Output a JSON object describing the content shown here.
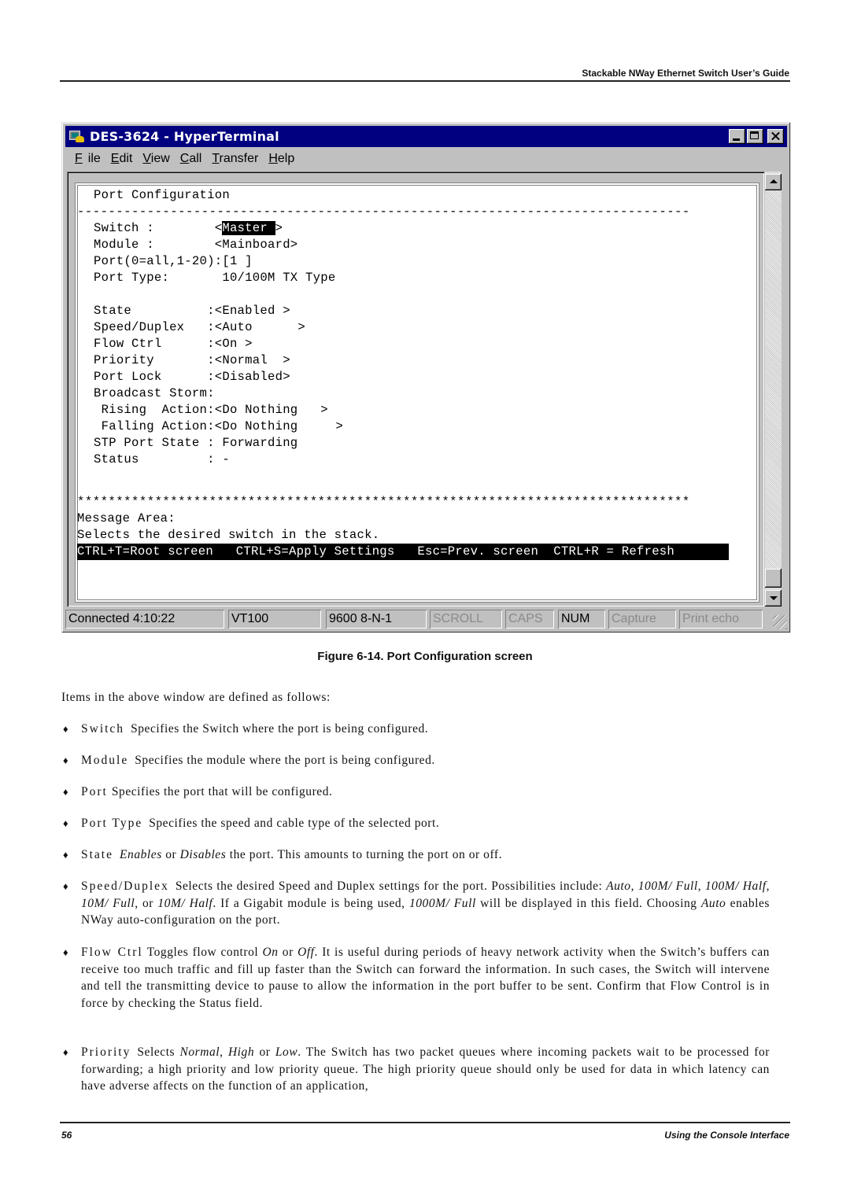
{
  "page": {
    "header_title": "Stackable NWay Ethernet Switch User’s Guide",
    "footer_page_number": "56",
    "footer_section": "Using the Console Interface",
    "figure_caption": "Figure 6-14.  Port Configuration screen"
  },
  "window": {
    "title": "DES-3624 - HyperTerminal",
    "menu": [
      {
        "label": "File",
        "accel": "F",
        "rest": "ile"
      },
      {
        "label": "Edit",
        "accel": "E",
        "rest": "dit"
      },
      {
        "label": "View",
        "accel": "V",
        "rest": "iew"
      },
      {
        "label": "Call",
        "accel": "C",
        "rest": "all"
      },
      {
        "label": "Transfer",
        "accel": "T",
        "rest": "ransfer"
      },
      {
        "label": "Help",
        "accel": "H",
        "rest": "elp"
      }
    ],
    "controls": {
      "minimize": "minimize",
      "maximize": "maximize",
      "close": "close"
    }
  },
  "terminal": {
    "heading": "Port Configuration",
    "dash_rule": "-------------------------------------------------------------------------------",
    "switch_label": "Switch :        <",
    "switch_value": "Master ",
    "switch_suffix": ">",
    "module_line": "Module :        <Mainboard>",
    "port_line": "Port(0=all,1-20):[1 ]",
    "port_type_line": "Port Type:       10/100M TX Type",
    "fields": [
      "State          :<Enabled >",
      "Speed/Duplex   :<Auto      >",
      "Flow Ctrl      :<On >",
      "Priority       :<Normal  >",
      "Port Lock      :<Disabled>",
      "Broadcast Storm:",
      " Rising  Action:<Do Nothing   >",
      " Falling Action:<Do Nothing     >",
      "STP Port State : Forwarding",
      "Status         : -"
    ],
    "star_rule": "*******************************************************************************",
    "message_area_label": "Message Area:",
    "message": "Selects the desired switch in the stack.",
    "keybar": "CTRL+T=Root screen   CTRL+S=Apply Settings   Esc=Prev. screen  CTRL+R = Refresh"
  },
  "statusbar": {
    "connected": "Connected 4:10:22",
    "emulation": "VT100",
    "port_settings": "9600 8-N-1",
    "scroll": "SCROLL",
    "caps": "CAPS",
    "num": "NUM",
    "capture": "Capture",
    "print_echo": "Print echo"
  },
  "body": {
    "intro": "Items in the above window are defined as follows:",
    "items": [
      {
        "term": "Switch",
        "text": "Specifies the Switch where the port is being configured."
      },
      {
        "term": "Module",
        "text": "Specifies the module where the port is being configured."
      },
      {
        "term": "Port",
        "text": "Specifies the port that will be configured."
      },
      {
        "term": "Port Type",
        "text": "Specifies the speed and cable type of the selected port."
      },
      {
        "term": "State",
        "parts": [
          "Enables",
          " or ",
          "Disables",
          " the port. This amounts to turning the port on or off."
        ]
      },
      {
        "term": "Speed/Duplex",
        "parts": [
          "Selects the desired Speed and Duplex settings for the port. Possibilities include: ",
          "Auto",
          ", ",
          "100M/ Full",
          ", ",
          "100M/ Half",
          ", ",
          "10M/ Full",
          ", or ",
          "10M/ Half",
          ". If a Gigabit module is being used, ",
          "1000M/ Full",
          " will be displayed in this field. Choosing ",
          "Auto",
          " enables NWay auto-configuration on the port."
        ]
      },
      {
        "term": "Flow Ctrl",
        "parts": [
          "Toggles flow control ",
          "On",
          " or ",
          "Off",
          ". It is useful during periods of heavy network activity when the Switch’s buffers can receive too much traffic and fill up faster than the Switch can forward the information. In such cases, the Switch will intervene and tell the transmitting device to pause to allow the information in the port buffer to be sent. Confirm that Flow Control is in force by checking the Status field."
        ]
      },
      {
        "term": "Priority",
        "parts": [
          "Selects ",
          "Normal",
          ", ",
          "High",
          " or ",
          "Low",
          ". The Switch has two packet queues where incoming packets wait to be processed for forwarding; a high priority and low priority queue. The high priority queue should only be used for data in which latency can have adverse affects on the function of an application,"
        ]
      }
    ]
  }
}
